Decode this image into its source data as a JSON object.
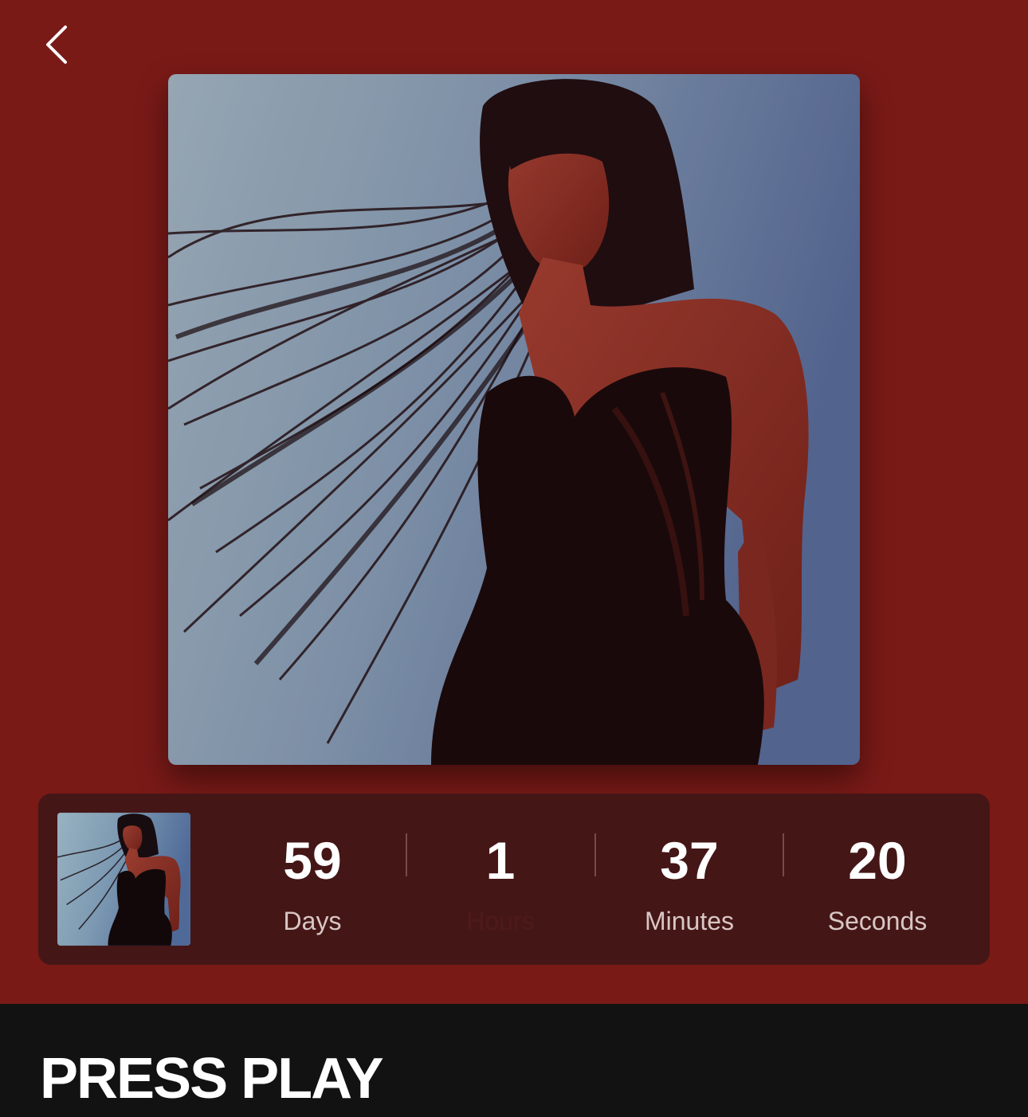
{
  "header": {
    "back_icon": "chevron-left-icon"
  },
  "cover": {
    "alt_icon": "album-cover"
  },
  "countdown": {
    "units": [
      {
        "value": "59",
        "label": "Days"
      },
      {
        "value": "1",
        "label": "Hours"
      },
      {
        "value": "37",
        "label": "Minutes"
      },
      {
        "value": "20",
        "label": "Seconds"
      }
    ]
  },
  "section": {
    "title": "PRESS PLAY"
  },
  "colors": {
    "background": "#7a1a17",
    "card": "#451616",
    "footer": "#121212"
  }
}
